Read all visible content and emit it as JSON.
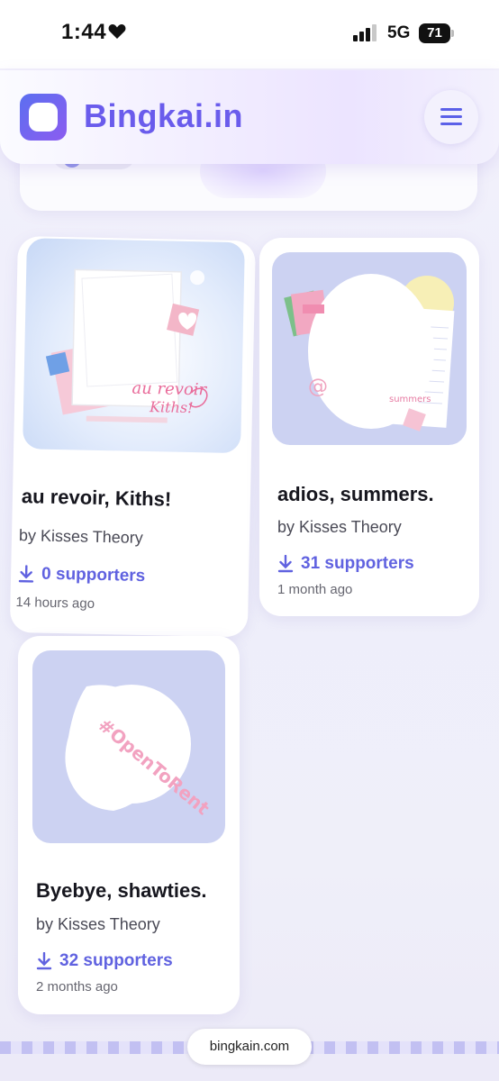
{
  "status_bar": {
    "time": "1:44",
    "network": "5G",
    "battery": "71"
  },
  "header": {
    "brand": "Bingkai.in",
    "logo_icon": "bingkai-logo-icon",
    "menu_icon": "hamburger-menu-icon"
  },
  "cards": [
    {
      "title": "au revoir, Kiths!",
      "author": "by Kisses Theory",
      "supporters": "0 supporters",
      "time": "14 hours ago",
      "thumb_text": "au revoir, Kiths!"
    },
    {
      "title": "adios, summers.",
      "author": "by Kisses Theory",
      "supporters": "31 supporters",
      "time": "1 month ago",
      "thumb_text": "summers"
    },
    {
      "title": "Byebye, shawties.",
      "author": "by Kisses Theory",
      "supporters": "32 supporters",
      "time": "2 months ago",
      "thumb_text": "#OpenToRent"
    }
  ],
  "footer": {
    "url": "bingkain.com"
  },
  "colors": {
    "accent": "#6062e0",
    "brand": "#6a5cec",
    "thumb_blue": "#ccd2f2",
    "pink": "#f3a9c6"
  }
}
